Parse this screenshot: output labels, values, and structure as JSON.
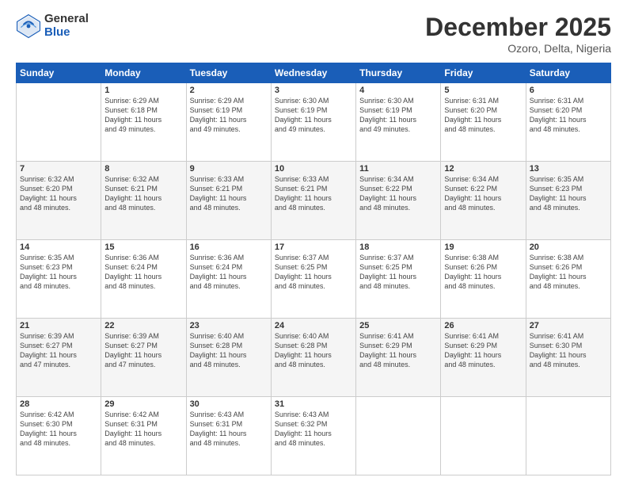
{
  "header": {
    "logo_general": "General",
    "logo_blue": "Blue",
    "title": "December 2025",
    "location": "Ozoro, Delta, Nigeria"
  },
  "weekdays": [
    "Sunday",
    "Monday",
    "Tuesday",
    "Wednesday",
    "Thursday",
    "Friday",
    "Saturday"
  ],
  "weeks": [
    [
      {
        "day": "",
        "info": ""
      },
      {
        "day": "1",
        "info": "Sunrise: 6:29 AM\nSunset: 6:18 PM\nDaylight: 11 hours\nand 49 minutes."
      },
      {
        "day": "2",
        "info": "Sunrise: 6:29 AM\nSunset: 6:19 PM\nDaylight: 11 hours\nand 49 minutes."
      },
      {
        "day": "3",
        "info": "Sunrise: 6:30 AM\nSunset: 6:19 PM\nDaylight: 11 hours\nand 49 minutes."
      },
      {
        "day": "4",
        "info": "Sunrise: 6:30 AM\nSunset: 6:19 PM\nDaylight: 11 hours\nand 49 minutes."
      },
      {
        "day": "5",
        "info": "Sunrise: 6:31 AM\nSunset: 6:20 PM\nDaylight: 11 hours\nand 48 minutes."
      },
      {
        "day": "6",
        "info": "Sunrise: 6:31 AM\nSunset: 6:20 PM\nDaylight: 11 hours\nand 48 minutes."
      }
    ],
    [
      {
        "day": "7",
        "info": "Sunrise: 6:32 AM\nSunset: 6:20 PM\nDaylight: 11 hours\nand 48 minutes."
      },
      {
        "day": "8",
        "info": "Sunrise: 6:32 AM\nSunset: 6:21 PM\nDaylight: 11 hours\nand 48 minutes."
      },
      {
        "day": "9",
        "info": "Sunrise: 6:33 AM\nSunset: 6:21 PM\nDaylight: 11 hours\nand 48 minutes."
      },
      {
        "day": "10",
        "info": "Sunrise: 6:33 AM\nSunset: 6:21 PM\nDaylight: 11 hours\nand 48 minutes."
      },
      {
        "day": "11",
        "info": "Sunrise: 6:34 AM\nSunset: 6:22 PM\nDaylight: 11 hours\nand 48 minutes."
      },
      {
        "day": "12",
        "info": "Sunrise: 6:34 AM\nSunset: 6:22 PM\nDaylight: 11 hours\nand 48 minutes."
      },
      {
        "day": "13",
        "info": "Sunrise: 6:35 AM\nSunset: 6:23 PM\nDaylight: 11 hours\nand 48 minutes."
      }
    ],
    [
      {
        "day": "14",
        "info": "Sunrise: 6:35 AM\nSunset: 6:23 PM\nDaylight: 11 hours\nand 48 minutes."
      },
      {
        "day": "15",
        "info": "Sunrise: 6:36 AM\nSunset: 6:24 PM\nDaylight: 11 hours\nand 48 minutes."
      },
      {
        "day": "16",
        "info": "Sunrise: 6:36 AM\nSunset: 6:24 PM\nDaylight: 11 hours\nand 48 minutes."
      },
      {
        "day": "17",
        "info": "Sunrise: 6:37 AM\nSunset: 6:25 PM\nDaylight: 11 hours\nand 48 minutes."
      },
      {
        "day": "18",
        "info": "Sunrise: 6:37 AM\nSunset: 6:25 PM\nDaylight: 11 hours\nand 48 minutes."
      },
      {
        "day": "19",
        "info": "Sunrise: 6:38 AM\nSunset: 6:26 PM\nDaylight: 11 hours\nand 48 minutes."
      },
      {
        "day": "20",
        "info": "Sunrise: 6:38 AM\nSunset: 6:26 PM\nDaylight: 11 hours\nand 48 minutes."
      }
    ],
    [
      {
        "day": "21",
        "info": "Sunrise: 6:39 AM\nSunset: 6:27 PM\nDaylight: 11 hours\nand 47 minutes."
      },
      {
        "day": "22",
        "info": "Sunrise: 6:39 AM\nSunset: 6:27 PM\nDaylight: 11 hours\nand 47 minutes."
      },
      {
        "day": "23",
        "info": "Sunrise: 6:40 AM\nSunset: 6:28 PM\nDaylight: 11 hours\nand 48 minutes."
      },
      {
        "day": "24",
        "info": "Sunrise: 6:40 AM\nSunset: 6:28 PM\nDaylight: 11 hours\nand 48 minutes."
      },
      {
        "day": "25",
        "info": "Sunrise: 6:41 AM\nSunset: 6:29 PM\nDaylight: 11 hours\nand 48 minutes."
      },
      {
        "day": "26",
        "info": "Sunrise: 6:41 AM\nSunset: 6:29 PM\nDaylight: 11 hours\nand 48 minutes."
      },
      {
        "day": "27",
        "info": "Sunrise: 6:41 AM\nSunset: 6:30 PM\nDaylight: 11 hours\nand 48 minutes."
      }
    ],
    [
      {
        "day": "28",
        "info": "Sunrise: 6:42 AM\nSunset: 6:30 PM\nDaylight: 11 hours\nand 48 minutes."
      },
      {
        "day": "29",
        "info": "Sunrise: 6:42 AM\nSunset: 6:31 PM\nDaylight: 11 hours\nand 48 minutes."
      },
      {
        "day": "30",
        "info": "Sunrise: 6:43 AM\nSunset: 6:31 PM\nDaylight: 11 hours\nand 48 minutes."
      },
      {
        "day": "31",
        "info": "Sunrise: 6:43 AM\nSunset: 6:32 PM\nDaylight: 11 hours\nand 48 minutes."
      },
      {
        "day": "",
        "info": ""
      },
      {
        "day": "",
        "info": ""
      },
      {
        "day": "",
        "info": ""
      }
    ]
  ]
}
